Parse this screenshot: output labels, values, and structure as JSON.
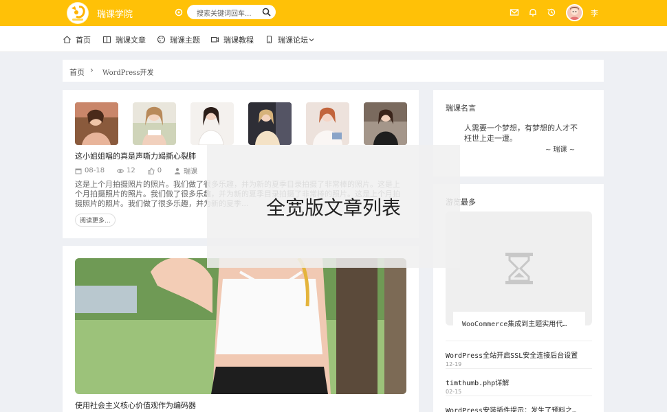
{
  "header": {
    "site_name": "瑞课学院",
    "search_placeholder": "搜索关键词回车...",
    "username": "李"
  },
  "nav": {
    "items": [
      {
        "label": "首页",
        "icon": "home-icon"
      },
      {
        "label": "瑞课文章",
        "icon": "book-icon"
      },
      {
        "label": "瑞课主题",
        "icon": "palette-icon"
      },
      {
        "label": "瑞课教程",
        "icon": "video-icon"
      },
      {
        "label": "瑞课论坛",
        "icon": "phone-icon"
      }
    ]
  },
  "breadcrumb": {
    "home": "首页",
    "separator": "›",
    "current": "WordPress开发"
  },
  "posts": [
    {
      "title": "这小姐姐唱的真是声嘶力竭撕心裂肺",
      "date": "08-18",
      "views": "12",
      "likes": "0",
      "author": "瑞课",
      "excerpt": "这是上个月拍摄照片的照片。我们做了很多乐趣，并为新的夏季目录拍摄了非常棒的照片。这是上个月拍摄照片的照片。我们做了很多乐趣，并为新的夏季目录拍摄了非常棒的照片。这是上个月拍摄照片的照片。我们做了很多乐趣，并为新的夏季...",
      "read_more": "阅读更多..."
    },
    {
      "title": "使用社会主义核心价值观作为编码器"
    }
  ],
  "sidebar": {
    "quote_widget": {
      "title": "瑞课名言",
      "text": "人需要一个梦想，有梦想的人才不枉世上走一遭。",
      "author": "~ 瑞课 ~"
    },
    "popular_widget": {
      "title": "游览最多",
      "featured_caption": "WooCommerce集成到主题实用代…",
      "items": [
        {
          "title": "WordPress全站开启SSL安全连接后台设置",
          "date": "12-19"
        },
        {
          "title": "timthumb.php详解",
          "date": "02-15"
        },
        {
          "title": "WordPress安装插件提示：发生了预料之…",
          "date": ""
        }
      ]
    }
  },
  "overlay": {
    "text": "全宽版文章列表"
  },
  "colors": {
    "brand": "#ffc107",
    "background": "#eef0f4"
  }
}
